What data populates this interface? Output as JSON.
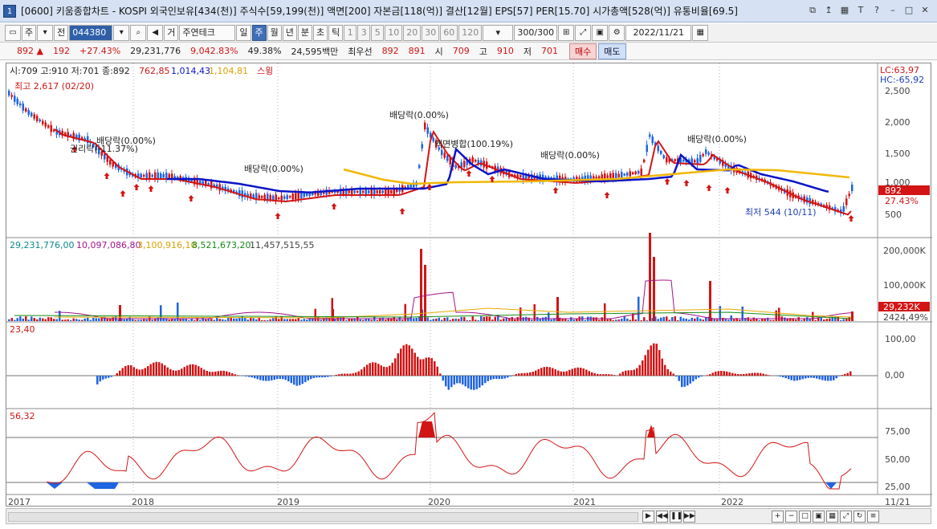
{
  "window": {
    "title": "[0600] 키움종합차트 - KOSPI 외국인보유[434(천)] 주식수[59,199(천)] 액면[200] 자본금[118(억)] 결산[12월] EPS[57] PER[15.70] 시가총액[528(억)] 유통비율[69.5]",
    "badge": "1"
  },
  "toolbar": {
    "period_buttons": [
      "주",
      "전"
    ],
    "code": "044380",
    "stock_name": "주연테크",
    "kind_label": "거",
    "timeframes": [
      "일",
      "주",
      "월",
      "년",
      "분",
      "초",
      "틱"
    ],
    "selected_timeframe": "주",
    "numbers": [
      "1",
      "3",
      "5",
      "10",
      "20",
      "30",
      "60",
      "120"
    ],
    "count": "300/300",
    "date": "2022/11/21"
  },
  "info": {
    "price": "892",
    "change": "192",
    "change_pct": "+27.43%",
    "volume": "29,231,776",
    "volume_pct": "9,042.83%",
    "turnover": "49.38%",
    "amount": "24,595백만",
    "best_bid_label": "최우선",
    "best_ask": "892",
    "best_bid": "891",
    "open_label": "시",
    "open": "709",
    "high_label": "고",
    "high": "910",
    "low_label": "저",
    "low": "701",
    "buy": "매수",
    "sell": "매도"
  },
  "panel1": {
    "header": {
      "ohlc": "시:709 고:910 저:701 종:892",
      "ma1": "762,85",
      "ma2": "1,014,43",
      "ma3": "1,104,81",
      "swing": "스윙"
    },
    "lc": "LC:63,97",
    "hc": "HC:-65,92",
    "axis": [
      "2,500",
      "2,000",
      "1,500",
      "1,000",
      "500"
    ],
    "price_tag": "892",
    "pct_tag": "27.43%",
    "high_note": "최고 2,617 (02/20)",
    "low_note": "최저 544 (10/11)",
    "annotations": [
      "권리락(-11.37%)",
      "배당락(0.00%)",
      "배당락(0.00%)",
      "배당락(0.00%)",
      "액면병합(100.19%)",
      "배당락(0.00%)",
      "배당락(0.00%)"
    ]
  },
  "panel2": {
    "header": [
      "29,231,776,00",
      "10,097,086,80",
      "3,100,916,10",
      "8,521,673,20",
      "11,457,515,55"
    ],
    "axis": [
      "200,000K",
      "100,000K"
    ],
    "tag": "29,232K",
    "tag2": "2424,49%"
  },
  "panel3": {
    "header": "23,40",
    "axis": [
      "100,00",
      "0,00"
    ]
  },
  "panel4": {
    "header": "56,32",
    "axis": [
      "75,00",
      "50,00",
      "25,00"
    ]
  },
  "xaxis": [
    "2017",
    "2018",
    "2019",
    "2020",
    "2021",
    "2022",
    "11/21"
  ],
  "colors": {
    "up": "#d21414",
    "down": "#1f64e0",
    "ma_blue": "#0a14c8",
    "ma_yellow": "#f2b705"
  }
}
